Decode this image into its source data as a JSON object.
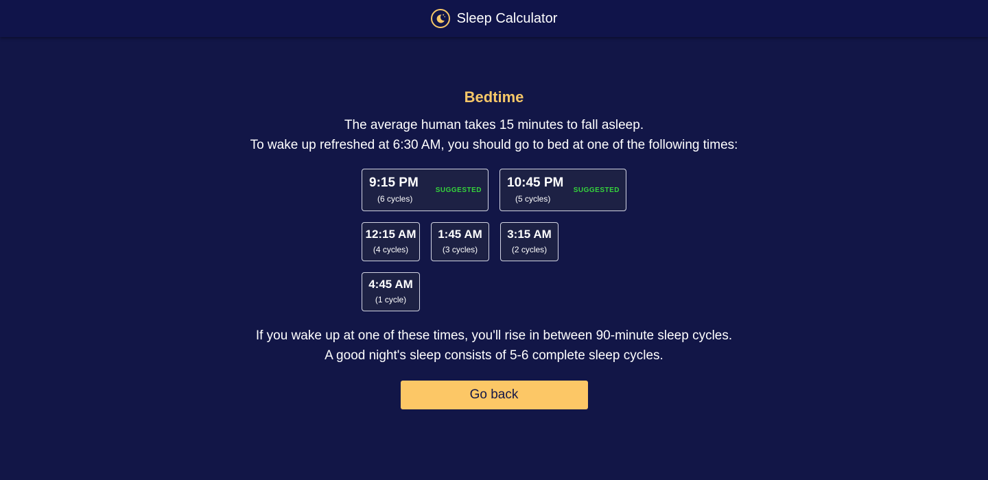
{
  "header": {
    "title": "Sleep Calculator",
    "logo_icon": "moon-stars-icon",
    "accent_color": "#f6c768"
  },
  "main": {
    "title": "Bedtime",
    "intro_line1": "The average human takes 15 minutes to fall asleep.",
    "intro_line2": "To wake up refreshed at 6:30 AM, you should go to bed at one of the following times:",
    "options": [
      {
        "time": "9:15 PM",
        "cycles": "(6 cycles)",
        "badge": "SUGGESTED"
      },
      {
        "time": "10:45 PM",
        "cycles": "(5 cycles)",
        "badge": "SUGGESTED"
      },
      {
        "time": "12:15 AM",
        "cycles": "(4 cycles)"
      },
      {
        "time": "1:45 AM",
        "cycles": "(3 cycles)"
      },
      {
        "time": "3:15 AM",
        "cycles": "(2 cycles)"
      },
      {
        "time": "4:45 AM",
        "cycles": "(1 cycle)"
      }
    ],
    "outro_line1": "If you wake up at one of these times, you'll rise in between 90-minute sleep cycles.",
    "outro_line2": "A good night's sleep consists of 5-6 complete sleep cycles.",
    "back_button": "Go back",
    "badge_color": "#35d43c",
    "button_color": "#fcc766"
  }
}
